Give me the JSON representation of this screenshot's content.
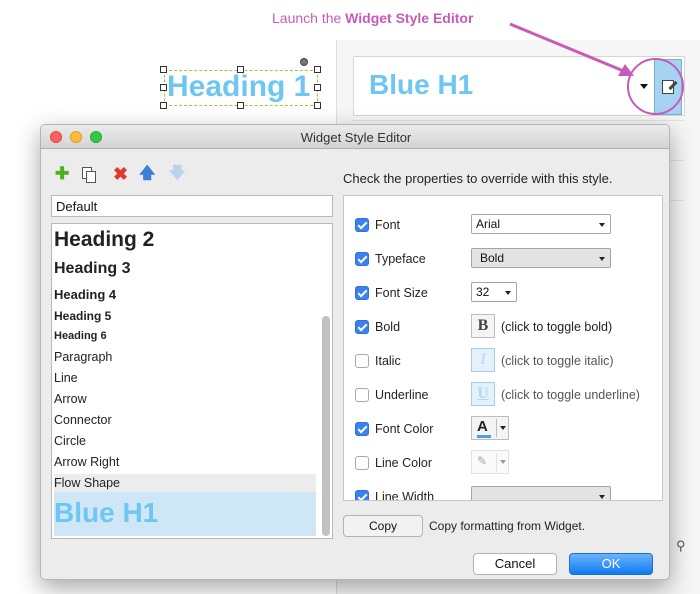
{
  "annotation": {
    "prefix": "Launch the ",
    "emphasis": "Widget Style Editor"
  },
  "canvas": {
    "heading_text": "Heading 1"
  },
  "style_panel": {
    "current_style": "Blue H1"
  },
  "dialog": {
    "title": "Widget Style Editor",
    "style_name_value": "Default",
    "styles": [
      {
        "label": "Heading 2"
      },
      {
        "label": "Heading 3"
      },
      {
        "label": "Heading 4"
      },
      {
        "label": "Heading 5"
      },
      {
        "label": "Heading 6"
      },
      {
        "label": "Paragraph"
      },
      {
        "label": "Line"
      },
      {
        "label": "Arrow"
      },
      {
        "label": "Connector"
      },
      {
        "label": "Circle"
      },
      {
        "label": "Arrow Right"
      },
      {
        "label": "Flow Shape"
      },
      {
        "label": "Blue H1"
      }
    ],
    "instructions": "Check the properties to override with this style.",
    "properties": [
      {
        "label": "Font",
        "checked": true,
        "value": "Arial"
      },
      {
        "label": "Typeface",
        "checked": true,
        "value": "Bold"
      },
      {
        "label": "Font Size",
        "checked": true,
        "value": "32"
      },
      {
        "label": "Bold",
        "checked": true,
        "button": "B",
        "desc": "(click to toggle bold)"
      },
      {
        "label": "Italic",
        "checked": false,
        "button": "I",
        "desc": "(click to toggle italic)"
      },
      {
        "label": "Underline",
        "checked": false,
        "button": "U",
        "desc": "(click to toggle underline)"
      },
      {
        "label": "Font Color",
        "checked": true,
        "glyph": "A"
      },
      {
        "label": "Line Color",
        "checked": false
      },
      {
        "label": "Line Width",
        "checked": true,
        "value": ""
      }
    ],
    "copy_label": "Copy",
    "copy_desc": "Copy formatting from Widget.",
    "cancel_label": "Cancel",
    "ok_label": "OK"
  },
  "colors": {
    "accent_blue": "#6ec6f2",
    "annotation_pink": "#c75bb7",
    "checkbox_blue": "#3b82f0",
    "add_green": "#4caf1e",
    "delete_red": "#e03a2e"
  },
  "icons": [
    "add-icon",
    "duplicate-icon",
    "delete-icon",
    "move-up-icon",
    "move-down-icon",
    "edit-style-icon",
    "search-icon"
  ]
}
